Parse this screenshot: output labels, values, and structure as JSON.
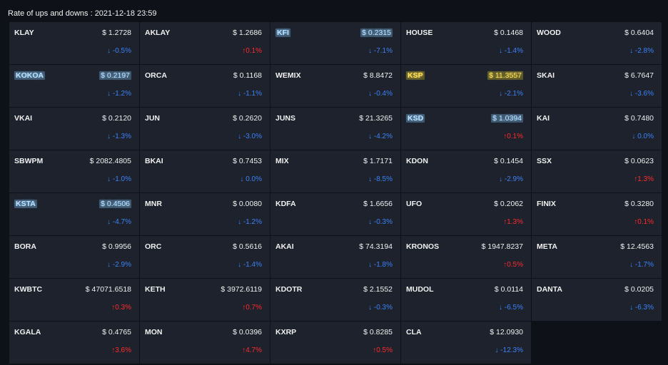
{
  "header": {
    "title": "Rate of ups and downs : 2021-12-18 23:59"
  },
  "tokens": [
    {
      "name": "KLAY",
      "price": "$ 1.2728",
      "change": "↓ -0.5%",
      "dir": "down",
      "hl": ""
    },
    {
      "name": "AKLAY",
      "price": "$ 1.2686",
      "change": "↑0.1%",
      "dir": "up",
      "hl": ""
    },
    {
      "name": "KFI",
      "price": "$ 0.2315",
      "change": "↓ -7.1%",
      "dir": "down",
      "hl": "blue"
    },
    {
      "name": "HOUSE",
      "price": "$ 0.1468",
      "change": "↓ -1.4%",
      "dir": "down",
      "hl": ""
    },
    {
      "name": "WOOD",
      "price": "$ 0.6404",
      "change": "↓ -2.8%",
      "dir": "down",
      "hl": ""
    },
    {
      "name": "KOKOA",
      "price": "$ 0.2197",
      "change": "↓ -1.2%",
      "dir": "down",
      "hl": "blue"
    },
    {
      "name": "ORCA",
      "price": "$ 0.1168",
      "change": "↓ -1.1%",
      "dir": "down",
      "hl": ""
    },
    {
      "name": "WEMIX",
      "price": "$ 8.8472",
      "change": "↓ -0.4%",
      "dir": "down",
      "hl": ""
    },
    {
      "name": "KSP",
      "price": "$ 11.3557",
      "change": "↓ -2.1%",
      "dir": "down",
      "hl": "yellow"
    },
    {
      "name": "SKAI",
      "price": "$ 6.7647",
      "change": "↓ -3.6%",
      "dir": "down",
      "hl": ""
    },
    {
      "name": "VKAI",
      "price": "$ 0.2120",
      "change": "↓ -1.3%",
      "dir": "down",
      "hl": ""
    },
    {
      "name": "JUN",
      "price": "$ 0.2620",
      "change": "↓ -3.0%",
      "dir": "down",
      "hl": ""
    },
    {
      "name": "JUNS",
      "price": "$ 21.3265",
      "change": "↓ -4.2%",
      "dir": "down",
      "hl": ""
    },
    {
      "name": "KSD",
      "price": "$ 1.0394",
      "change": "↑0.1%",
      "dir": "up",
      "hl": "blue"
    },
    {
      "name": "KAI",
      "price": "$ 0.7480",
      "change": "↓ 0.0%",
      "dir": "down",
      "hl": ""
    },
    {
      "name": "SBWPM",
      "price": "$ 2082.4805",
      "change": "↓ -1.0%",
      "dir": "down",
      "hl": ""
    },
    {
      "name": "BKAI",
      "price": "$ 0.7453",
      "change": "↓ 0.0%",
      "dir": "down",
      "hl": ""
    },
    {
      "name": "MIX",
      "price": "$ 1.7171",
      "change": "↓ -8.5%",
      "dir": "down",
      "hl": ""
    },
    {
      "name": "KDON",
      "price": "$ 0.1454",
      "change": "↓ -2.9%",
      "dir": "down",
      "hl": ""
    },
    {
      "name": "SSX",
      "price": "$ 0.0623",
      "change": "↑1.3%",
      "dir": "up",
      "hl": ""
    },
    {
      "name": "KSTA",
      "price": "$ 0.4506",
      "change": "↓ -4.7%",
      "dir": "down",
      "hl": "blue"
    },
    {
      "name": "MNR",
      "price": "$ 0.0080",
      "change": "↓ -1.2%",
      "dir": "down",
      "hl": ""
    },
    {
      "name": "KDFA",
      "price": "$ 1.6656",
      "change": "↓ -0.3%",
      "dir": "down",
      "hl": ""
    },
    {
      "name": "UFO",
      "price": "$ 0.2062",
      "change": "↑1.3%",
      "dir": "up",
      "hl": ""
    },
    {
      "name": "FINIX",
      "price": "$ 0.3280",
      "change": "↑0.1%",
      "dir": "up",
      "hl": ""
    },
    {
      "name": "BORA",
      "price": "$ 0.9956",
      "change": "↓ -2.9%",
      "dir": "down",
      "hl": ""
    },
    {
      "name": "ORC",
      "price": "$ 0.5616",
      "change": "↓ -1.4%",
      "dir": "down",
      "hl": ""
    },
    {
      "name": "AKAI",
      "price": "$ 74.3194",
      "change": "↓ -1.8%",
      "dir": "down",
      "hl": ""
    },
    {
      "name": "KRONOS",
      "price": "$ 1947.8237",
      "change": "↑0.5%",
      "dir": "up",
      "hl": ""
    },
    {
      "name": "META",
      "price": "$ 12.4563",
      "change": "↓ -1.7%",
      "dir": "down",
      "hl": ""
    },
    {
      "name": "KWBTC",
      "price": "$ 47071.6518",
      "change": "↑0.3%",
      "dir": "up",
      "hl": ""
    },
    {
      "name": "KETH",
      "price": "$ 3972.6119",
      "change": "↑0.7%",
      "dir": "up",
      "hl": ""
    },
    {
      "name": "KDOTR",
      "price": "$ 2.1552",
      "change": "↓ -0.3%",
      "dir": "down",
      "hl": ""
    },
    {
      "name": "MUDOL",
      "price": "$ 0.0114",
      "change": "↓ -6.5%",
      "dir": "down",
      "hl": ""
    },
    {
      "name": "DANTA",
      "price": "$ 0.0205",
      "change": "↓ -6.3%",
      "dir": "down",
      "hl": ""
    },
    {
      "name": "KGALA",
      "price": "$ 0.4765",
      "change": "↑3.6%",
      "dir": "up",
      "hl": ""
    },
    {
      "name": "MON",
      "price": "$ 0.0396",
      "change": "↑4.7%",
      "dir": "up",
      "hl": ""
    },
    {
      "name": "KXRP",
      "price": "$ 0.8285",
      "change": "↑0.5%",
      "dir": "up",
      "hl": ""
    },
    {
      "name": "CLA",
      "price": "$ 12.0930",
      "change": "↓ -12.3%",
      "dir": "down",
      "hl": ""
    }
  ]
}
